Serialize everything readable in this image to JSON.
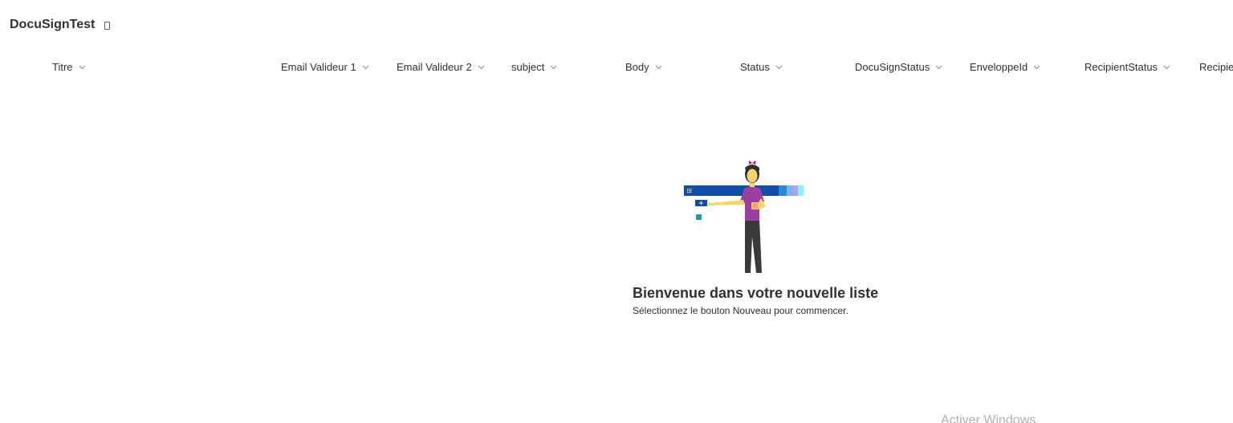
{
  "list": {
    "title": "DocuSignTest"
  },
  "columns": [
    {
      "label": "Titre"
    },
    {
      "label": "Email Valideur 1"
    },
    {
      "label": "Email Valideur 2"
    },
    {
      "label": "subject"
    },
    {
      "label": "Body"
    },
    {
      "label": "Status"
    },
    {
      "label": "DocuSignStatus"
    },
    {
      "label": "EnveloppeId"
    },
    {
      "label": "RecipientStatus"
    },
    {
      "label": "Recipie"
    }
  ],
  "empty_state": {
    "title": "Bienvenue dans votre nouvelle liste",
    "subtitle": "Sélectionnez le bouton Nouveau pour commencer."
  },
  "watermark": {
    "text": "Activer Windows"
  },
  "colors": {
    "accent_blue": "#0f4ea8",
    "shirt_purple": "#9b3fa3",
    "teal": "#13a2a5"
  }
}
